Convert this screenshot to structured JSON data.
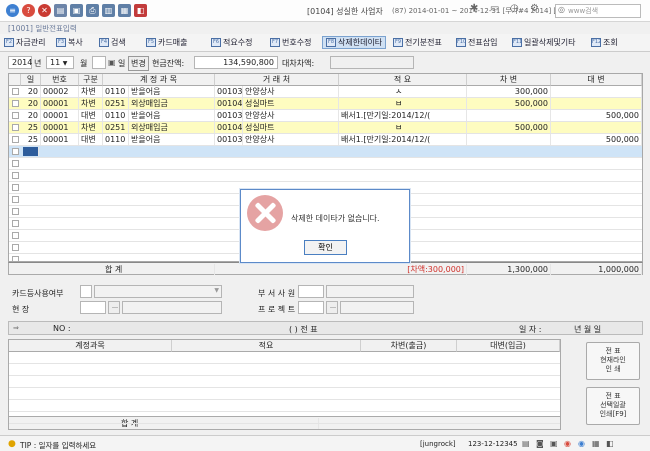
{
  "window": {
    "company_code": "[0104]",
    "company_name": "성실한 사업자",
    "company_info": "(87) 2014-01-01 ~ 2014-12-31 [무가#4 2014] [원천: 2014]",
    "search_placeholder": "www검색",
    "subtitle": "[1001] 일반전표입력"
  },
  "menu": [
    {
      "label": "자금관리",
      "key": "F2"
    },
    {
      "label": "복사",
      "key": "F3"
    },
    {
      "label": "검색",
      "key": "F4"
    },
    {
      "label": "카드매출",
      "key": "F5"
    },
    {
      "label": "적요수정",
      "key": "F6"
    },
    {
      "label": "번호수정",
      "key": "F7"
    },
    {
      "label": "삭제한데이타",
      "key": "F8"
    },
    {
      "label": "전기분전표",
      "key": "F9"
    },
    {
      "label": "전표삽입",
      "key": "F10"
    },
    {
      "label": "일괄삭제및기타",
      "key": "F11"
    },
    {
      "label": "조회",
      "key": "F12"
    }
  ],
  "filter": {
    "year": "2014",
    "year_unit": "년",
    "month": "11",
    "month_unit": "월",
    "day_unit": "일",
    "change_btn": "변경",
    "cash_label": "현금잔액:",
    "cash_value": "134,590,800",
    "balance_label": "대차차액:"
  },
  "grid": {
    "headers": [
      "일",
      "번호",
      "구분",
      "계 정 과 목",
      "거 래 처",
      "적 요",
      "차 변",
      "대 변"
    ],
    "rows": [
      {
        "day": "20",
        "no": "00002",
        "div": "차변",
        "acode": "0110",
        "acct": "받을어음",
        "pcode": "00103",
        "partner": "안양상사",
        "desc": "ㅅ",
        "debit": "300,000",
        "credit": "",
        "yellow": false
      },
      {
        "day": "20",
        "no": "00001",
        "div": "차변",
        "acode": "0251",
        "acct": "외상매입금",
        "pcode": "00104",
        "partner": "성실마트",
        "desc": "ㅂ",
        "debit": "500,000",
        "credit": "",
        "yellow": true
      },
      {
        "day": "20",
        "no": "00001",
        "div": "대변",
        "acode": "0110",
        "acct": "받을어음",
        "pcode": "00103",
        "partner": "안양상사",
        "desc": "배서1.[만기일:2014/12/(",
        "debit": "",
        "credit": "500,000",
        "yellow": false
      },
      {
        "day": "25",
        "no": "00001",
        "div": "차변",
        "acode": "0251",
        "acct": "외상매입금",
        "pcode": "00104",
        "partner": "성실마트",
        "desc": "ㅂ",
        "debit": "500,000",
        "credit": "",
        "yellow": true
      },
      {
        "day": "25",
        "no": "00001",
        "div": "대변",
        "acode": "0110",
        "acct": "받을어음",
        "pcode": "00103",
        "partner": "안양상사",
        "desc": "배서1.[만기일:2014/12/(",
        "debit": "",
        "credit": "500,000",
        "yellow": false
      }
    ],
    "total_label": "합       계",
    "total_diff": "[차액:300,000]",
    "total_debit": "1,300,000",
    "total_credit": "1,000,000"
  },
  "form": {
    "card_label": "카드등사용여부",
    "dept_label": "부 서 사 원",
    "site_label": "현          장",
    "project_label": "프 로 젝 트"
  },
  "voucher": {
    "no_label": "NO :",
    "title": "(            ) 전  표",
    "date_label": "일 자 :",
    "date_value": "년       월       일",
    "headers": [
      "계정과목",
      "적요",
      "차변(출금)",
      "대변(입금)"
    ],
    "total_label": "합                    계",
    "btn1": "전  표\n현재라인\n인  쇄",
    "btn2": "전  표\n선택일괄\n인쇄[F9]"
  },
  "status": {
    "tip": "TIP : 일자를 입력하세요",
    "user": "[jungrock]",
    "biz_no": "123-12-12345"
  },
  "dialog": {
    "message": "삭제한 데이타가 없습니다.",
    "ok": "확인"
  },
  "colors": {
    "accent": "#5c8ac9",
    "yellow_row": "#fefcc0",
    "diff_red": "#d0302a",
    "error_icon": "#e5a3a3"
  }
}
